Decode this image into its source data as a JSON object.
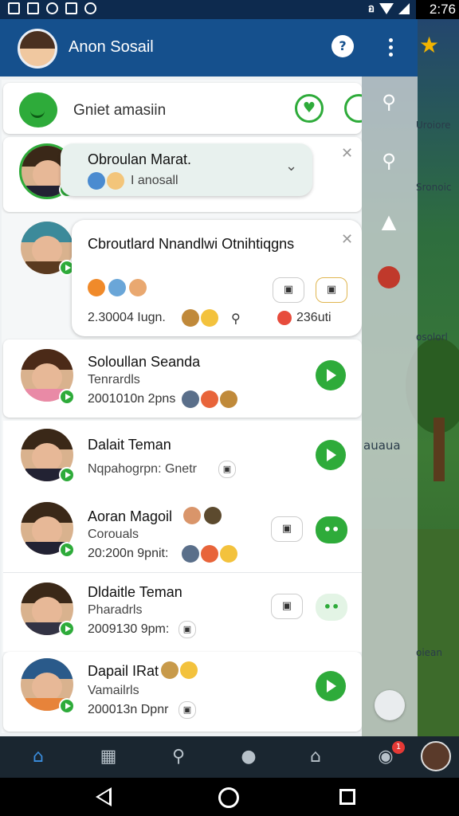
{
  "status_bar": {
    "time": "2:76",
    "bt_label": "อ"
  },
  "app_bar": {
    "title": "Anon Sosail"
  },
  "search": {
    "placeholder_text": "Gniet amasiin"
  },
  "rail": {
    "label1": "Uroiore",
    "label2": "Sronoic",
    "label3": "osolorl",
    "label4": "auaua",
    "label5": "oiean"
  },
  "chats": [
    {
      "name": "Obroulan Marat.",
      "sub": "I anosall"
    },
    {
      "name": "Cbroutlard Nnandlwi Otnihtiqgns",
      "meta": "2.30004 Iugn.",
      "meta2": "236uti"
    },
    {
      "name": "Soloullan Seanda",
      "sub": "Tenrardls",
      "meta": "2001010n 2pns"
    },
    {
      "name": "Dalait Teman",
      "sub": "Nqpahogrpn: Gnetr"
    },
    {
      "name": "Aoran Magoil",
      "sub": "Corouals",
      "meta": "20:200n 9pnit:"
    },
    {
      "name": "Dldaitle Teman",
      "sub": "Pharadrls",
      "meta": "2009130 9pm:"
    },
    {
      "name": "Dapail IRat",
      "sub": "Vamailrls",
      "meta": "200013n Dpnr"
    }
  ],
  "bottom_nav": {
    "badge": "1"
  },
  "colors": {
    "accent": "#2eab3a",
    "header": "#15508d",
    "nav": "#1a2630"
  }
}
